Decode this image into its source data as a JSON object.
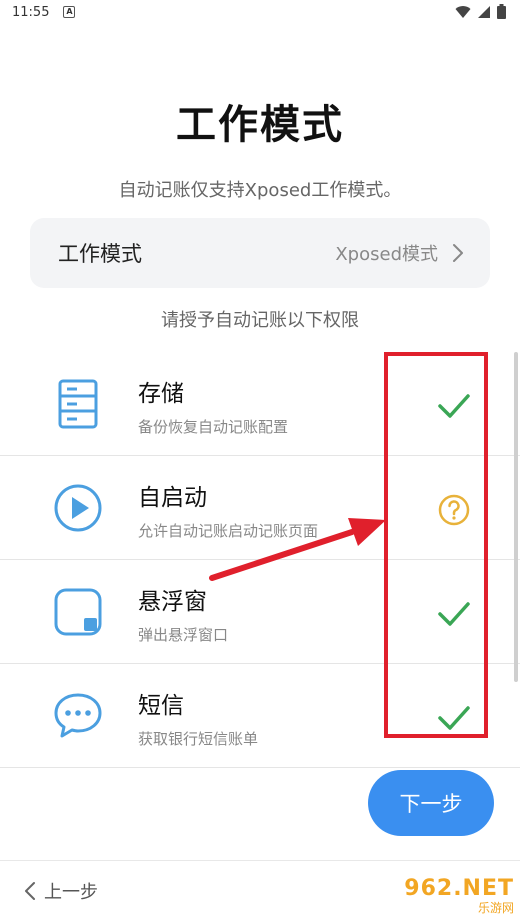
{
  "status_bar": {
    "time": "11:55",
    "notification_glyph": "A"
  },
  "title": "工作模式",
  "subtitle": "自动记账仅支持Xposed工作模式。",
  "mode_card": {
    "label": "工作模式",
    "value": "Xposed模式"
  },
  "permission_hint": "请授予自动记账以下权限",
  "permissions": [
    {
      "name": "存储",
      "desc": "备份恢复自动记账配置",
      "icon": "storage-icon",
      "status": "granted"
    },
    {
      "name": "自启动",
      "desc": "允许自动记账启动记账页面",
      "icon": "play-icon",
      "status": "unknown"
    },
    {
      "name": "悬浮窗",
      "desc": "弹出悬浮窗口",
      "icon": "floating-window-icon",
      "status": "granted"
    },
    {
      "name": "短信",
      "desc": "获取银行短信账单",
      "icon": "chat-icon",
      "status": "granted"
    }
  ],
  "next_button": "下一步",
  "prev_button": "上一步",
  "watermark": {
    "top": "962.NET",
    "bottom": "乐游网"
  },
  "colors": {
    "accent": "#3a8ff0",
    "icon": "#4b9fe0",
    "granted": "#3aa655",
    "unknown": "#e8b23a",
    "annotation": "#e0202c"
  }
}
